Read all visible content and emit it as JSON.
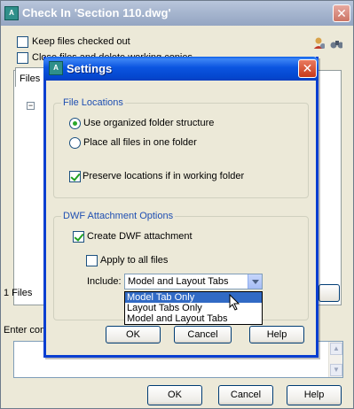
{
  "outer_window": {
    "title": "Check In 'Section 110.dwg'",
    "close_glyph": "✕",
    "keep_checked_out_label": "Keep files checked out",
    "close_files_label": "Close files and delete working copies",
    "tab_label": "Files",
    "tree_expander": "−",
    "status_text": "1 Files",
    "comment_label": "Enter comment",
    "buttons": {
      "ok": "OK",
      "cancel": "Cancel",
      "help": "Help"
    },
    "icons": [
      "user-settings-icon",
      "binoculars-icon"
    ]
  },
  "settings_dialog": {
    "title": "Settings",
    "close_glyph": "✕",
    "file_locations": {
      "legend": "File Locations",
      "option_organized": "Use organized folder structure",
      "option_one_folder": "Place all files in one folder",
      "preserve_label": "Preserve locations if in working folder",
      "selected": "organized",
      "preserve_checked": true
    },
    "dwf": {
      "legend": "DWF Attachment Options",
      "create_label": "Create DWF attachment",
      "create_checked": true,
      "apply_all_label": "Apply to all files",
      "apply_all_checked": false,
      "include_label": "Include:",
      "include_value": "Model and Layout Tabs",
      "include_options": [
        "Model Tab Only",
        "Layout Tabs Only",
        "Model and Layout Tabs"
      ],
      "highlighted_option": "Model Tab Only"
    },
    "buttons": {
      "ok": "OK",
      "cancel": "Cancel",
      "help": "Help"
    }
  },
  "colors": {
    "dialog_title": "#0b55e0",
    "legend_text": "#1f4fb2",
    "selection": "#316ac5"
  }
}
